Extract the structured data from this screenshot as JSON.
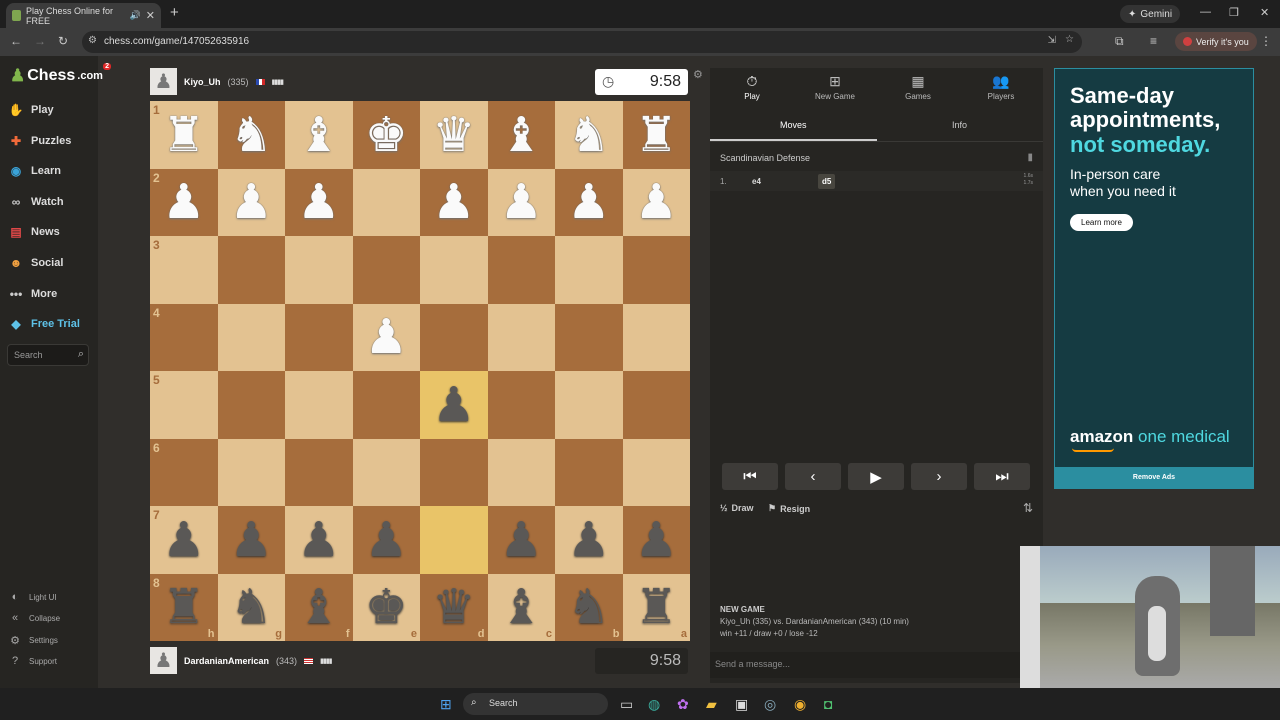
{
  "browser": {
    "tab_title": "Play Chess Online for FREE",
    "gemini": "Gemini",
    "url": "chess.com/game/147052635916",
    "verify": "Verify it's you"
  },
  "sidebar": {
    "logo": "Chess",
    "logo_suffix": ".com",
    "badge": "2",
    "items": [
      {
        "label": "Play",
        "icon": "play-hand-icon",
        "color": "#81b64c"
      },
      {
        "label": "Puzzles",
        "icon": "puzzle-icon",
        "color": "#f06a3a"
      },
      {
        "label": "Learn",
        "icon": "learn-icon",
        "color": "#3aa3d8"
      },
      {
        "label": "Watch",
        "icon": "binoculars-icon",
        "color": "#cccccc"
      },
      {
        "label": "News",
        "icon": "news-icon",
        "color": "#e04848"
      },
      {
        "label": "Social",
        "icon": "social-icon",
        "color": "#f0a040"
      },
      {
        "label": "More",
        "icon": "more-icon",
        "color": "#cccccc"
      },
      {
        "label": "Free Trial",
        "icon": "diamond-icon",
        "color": "#5ec2e8"
      }
    ],
    "search_placeholder": "Search",
    "bottom": [
      {
        "label": "Light UI",
        "icon": "light-ui-icon"
      },
      {
        "label": "Collapse",
        "icon": "collapse-icon"
      },
      {
        "label": "Settings",
        "icon": "gear-icon"
      },
      {
        "label": "Support",
        "icon": "help-icon"
      }
    ]
  },
  "top_player": {
    "name": "Kiyo_Uh",
    "rating": "(335)",
    "country": "France",
    "clock": "9:58"
  },
  "bottom_player": {
    "name": "DardanianAmerican",
    "rating": "(343)",
    "country": "United States",
    "clock": "9:58"
  },
  "board": {
    "light_color": "#e3c291",
    "dark_color": "#a66d3c",
    "highlight_color": "#d4a73d",
    "ranks_top_to_bottom": [
      "1",
      "2",
      "3",
      "4",
      "5",
      "6",
      "7",
      "8"
    ],
    "files_left_to_right": [
      "h",
      "g",
      "f",
      "e",
      "d",
      "c",
      "b",
      "a"
    ],
    "rows": [
      [
        "wR",
        "wN",
        "wB",
        "wK",
        "wQ",
        "wB",
        "wN",
        "wR"
      ],
      [
        "wP",
        "wP",
        "wP",
        "",
        "wP",
        "wP",
        "wP",
        "wP"
      ],
      [
        "",
        "",
        "",
        "",
        "",
        "",
        "",
        ""
      ],
      [
        "",
        "",
        "",
        "wP",
        "",
        "",
        "",
        ""
      ],
      [
        "",
        "",
        "",
        "",
        "bP",
        "",
        "",
        ""
      ],
      [
        "",
        "",
        "",
        "",
        "",
        "",
        "",
        ""
      ],
      [
        "bP",
        "bP",
        "bP",
        "bP",
        "",
        "bP",
        "bP",
        "bP"
      ],
      [
        "bR",
        "bN",
        "bB",
        "bK",
        "bQ",
        "bB",
        "bN",
        "bR"
      ]
    ],
    "highlighted": [
      "d7",
      "d5"
    ]
  },
  "panel": {
    "tabs": [
      {
        "label": "Play",
        "icon": "clock-icon"
      },
      {
        "label": "New Game",
        "icon": "plus-icon"
      },
      {
        "label": "Games",
        "icon": "board-icon"
      },
      {
        "label": "Players",
        "icon": "players-icon"
      }
    ],
    "subtabs": [
      "Moves",
      "Info"
    ],
    "opening": "Scandinavian Defense",
    "moves": [
      {
        "num": "1.",
        "white": "e4",
        "black": "d5",
        "white_time": "1.6s",
        "black_time": "1.7s"
      }
    ],
    "actions": {
      "draw": "Draw",
      "draw_icon": "½",
      "resign": "Resign"
    },
    "new_game_title": "NEW GAME",
    "new_game_line": "Kiyo_Uh (335) vs. DardanianAmerican (343) (10 min)",
    "new_game_stats": "win +11 / draw +0 / lose -12",
    "message_placeholder": "Send a message..."
  },
  "ad": {
    "headline": "Same-day\nappointments,",
    "headline_accent": "not someday.",
    "sub": "In-person care\nwhen you need it",
    "button": "Learn more",
    "brand": "amazon",
    "brand_accent": "one medical",
    "remove": "Remove Ads"
  },
  "taskbar": {
    "search": "Search"
  }
}
